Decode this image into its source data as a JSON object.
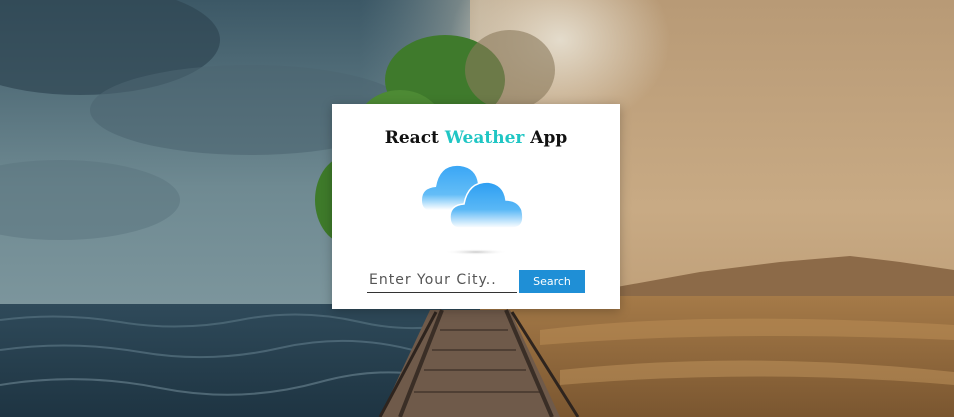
{
  "app": {
    "title_prefix": "React",
    "title_accent": "Weather",
    "title_suffix": "App",
    "accent_color": "#20c6c4"
  },
  "weather": {
    "icon": "cloud-icon"
  },
  "search": {
    "placeholder": "Enter Your City..",
    "value": "",
    "button_label": "Search",
    "button_color": "#1f8fd6"
  },
  "background": {
    "description_left": "stormy sea",
    "description_right": "desert"
  }
}
